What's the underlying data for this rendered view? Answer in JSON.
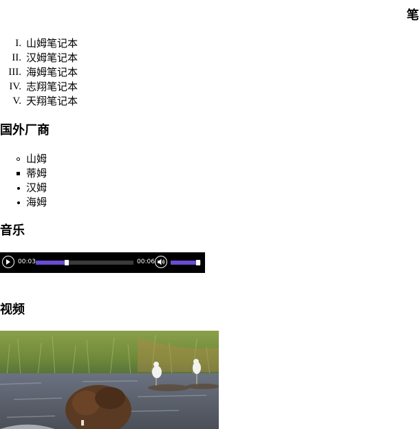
{
  "notebooks_heading": "笔",
  "notebooks": [
    {
      "marker": "I.",
      "label": "山姆笔记本"
    },
    {
      "marker": "II.",
      "label": "汉姆笔记本"
    },
    {
      "marker": "III.",
      "label": "海姆笔记本"
    },
    {
      "marker": "IV.",
      "label": "志翔笔记本"
    },
    {
      "marker": "V.",
      "label": "天翔笔记本"
    }
  ],
  "vendors_heading": "国外厂商",
  "vendors": [
    {
      "label": "山姆",
      "bullet": "circle"
    },
    {
      "label": "蒂姆",
      "bullet": "square"
    },
    {
      "label": "汉姆",
      "bullet": "disc"
    },
    {
      "label": "海姆",
      "bullet": "disc"
    }
  ],
  "music_heading": "音乐",
  "audio": {
    "current_time": "00:03",
    "duration": "00:06",
    "progress_fraction": 0.32,
    "volume_fraction": 0.9,
    "accent_color": "#6a4bd1"
  },
  "video_heading": "视频",
  "video": {
    "content": "bear-and-seagulls-in-river"
  }
}
